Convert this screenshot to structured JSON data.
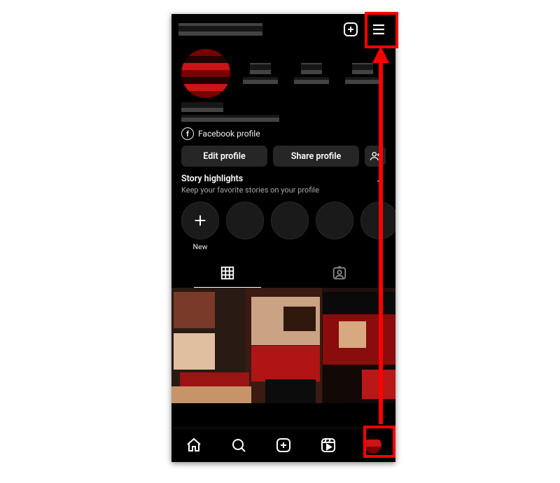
{
  "header": {
    "create_label": "Create",
    "menu_label": "Menu"
  },
  "fb": {
    "label": "Facebook profile"
  },
  "actions": {
    "edit": "Edit profile",
    "share": "Share profile",
    "discover": "Discover people"
  },
  "highlights": {
    "title": "Story highlights",
    "subtitle": "Keep your favorite stories on your profile",
    "new_label": "New"
  },
  "tabs": {
    "grid": "Posts",
    "tagged": "Tagged"
  },
  "nav": {
    "home": "Home",
    "search": "Search",
    "create": "Create",
    "reels": "Reels",
    "profile": "Profile"
  },
  "colors": {
    "accent_red": "#ff0000",
    "avatar_primary": "#c41e1e"
  }
}
